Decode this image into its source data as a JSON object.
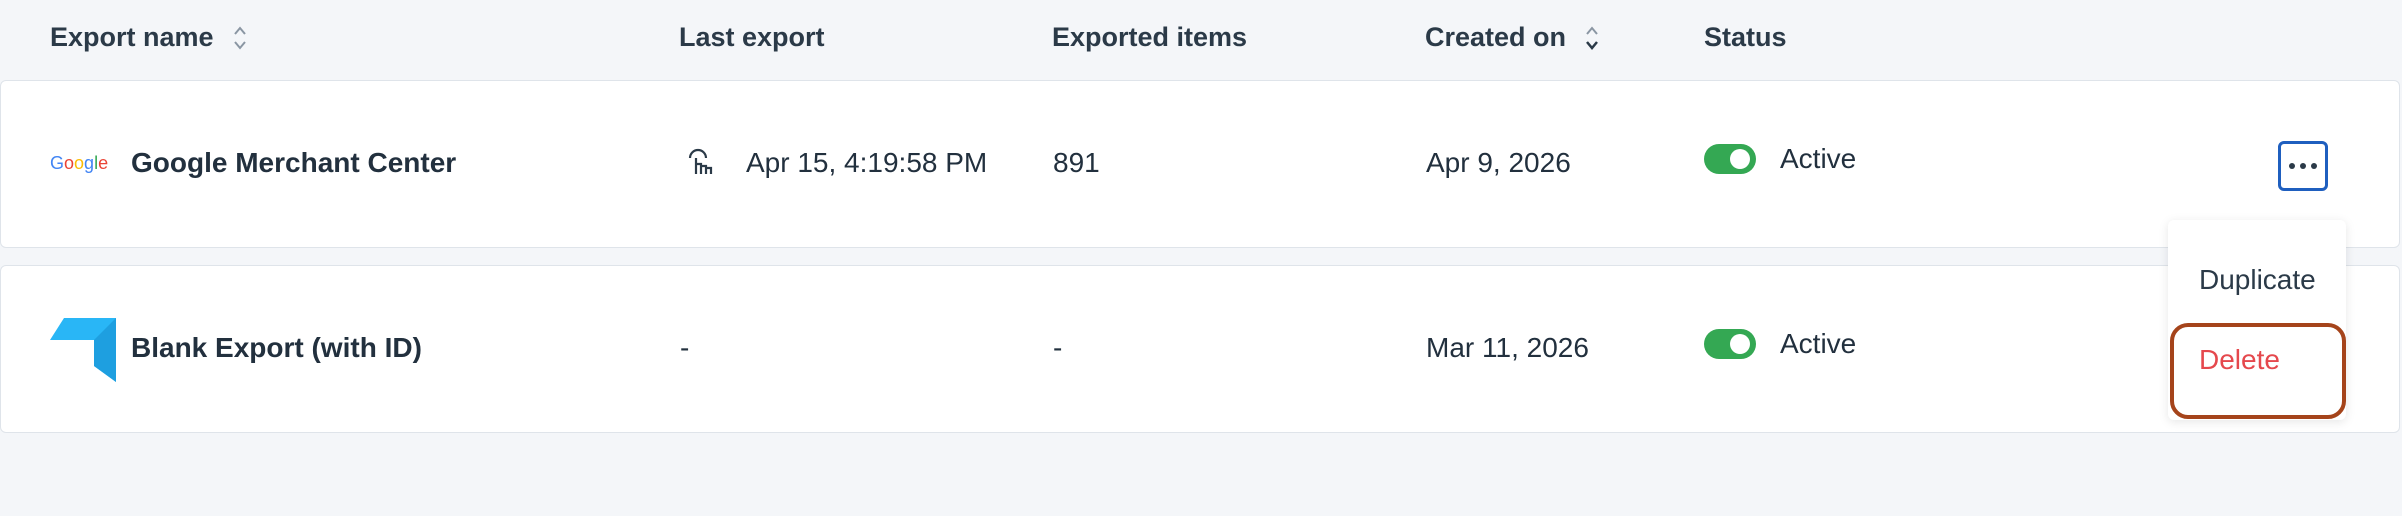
{
  "columns": {
    "export_name": "Export name",
    "last_export": "Last export",
    "exported_items": "Exported items",
    "created_on": "Created on",
    "status": "Status"
  },
  "rows": [
    {
      "name": "Google Merchant Center",
      "logo_text": "Google",
      "last_export": "Apr 15, 4:19:58 PM",
      "exported_items": "891",
      "created_on": "Apr 9, 2026",
      "status": "Active"
    },
    {
      "name": "Blank Export (with ID)",
      "last_export": "-",
      "exported_items": "-",
      "created_on": "Mar 11, 2026",
      "status": "Active"
    }
  ],
  "menu": {
    "duplicate": "Duplicate",
    "delete": "Delete"
  },
  "colors": {
    "toggle_on": "#34a853",
    "delete_text": "#e5484d",
    "focus_blue": "#1f5fbf",
    "highlight": "#a5441b",
    "logo_blue": "#29b6f6"
  }
}
